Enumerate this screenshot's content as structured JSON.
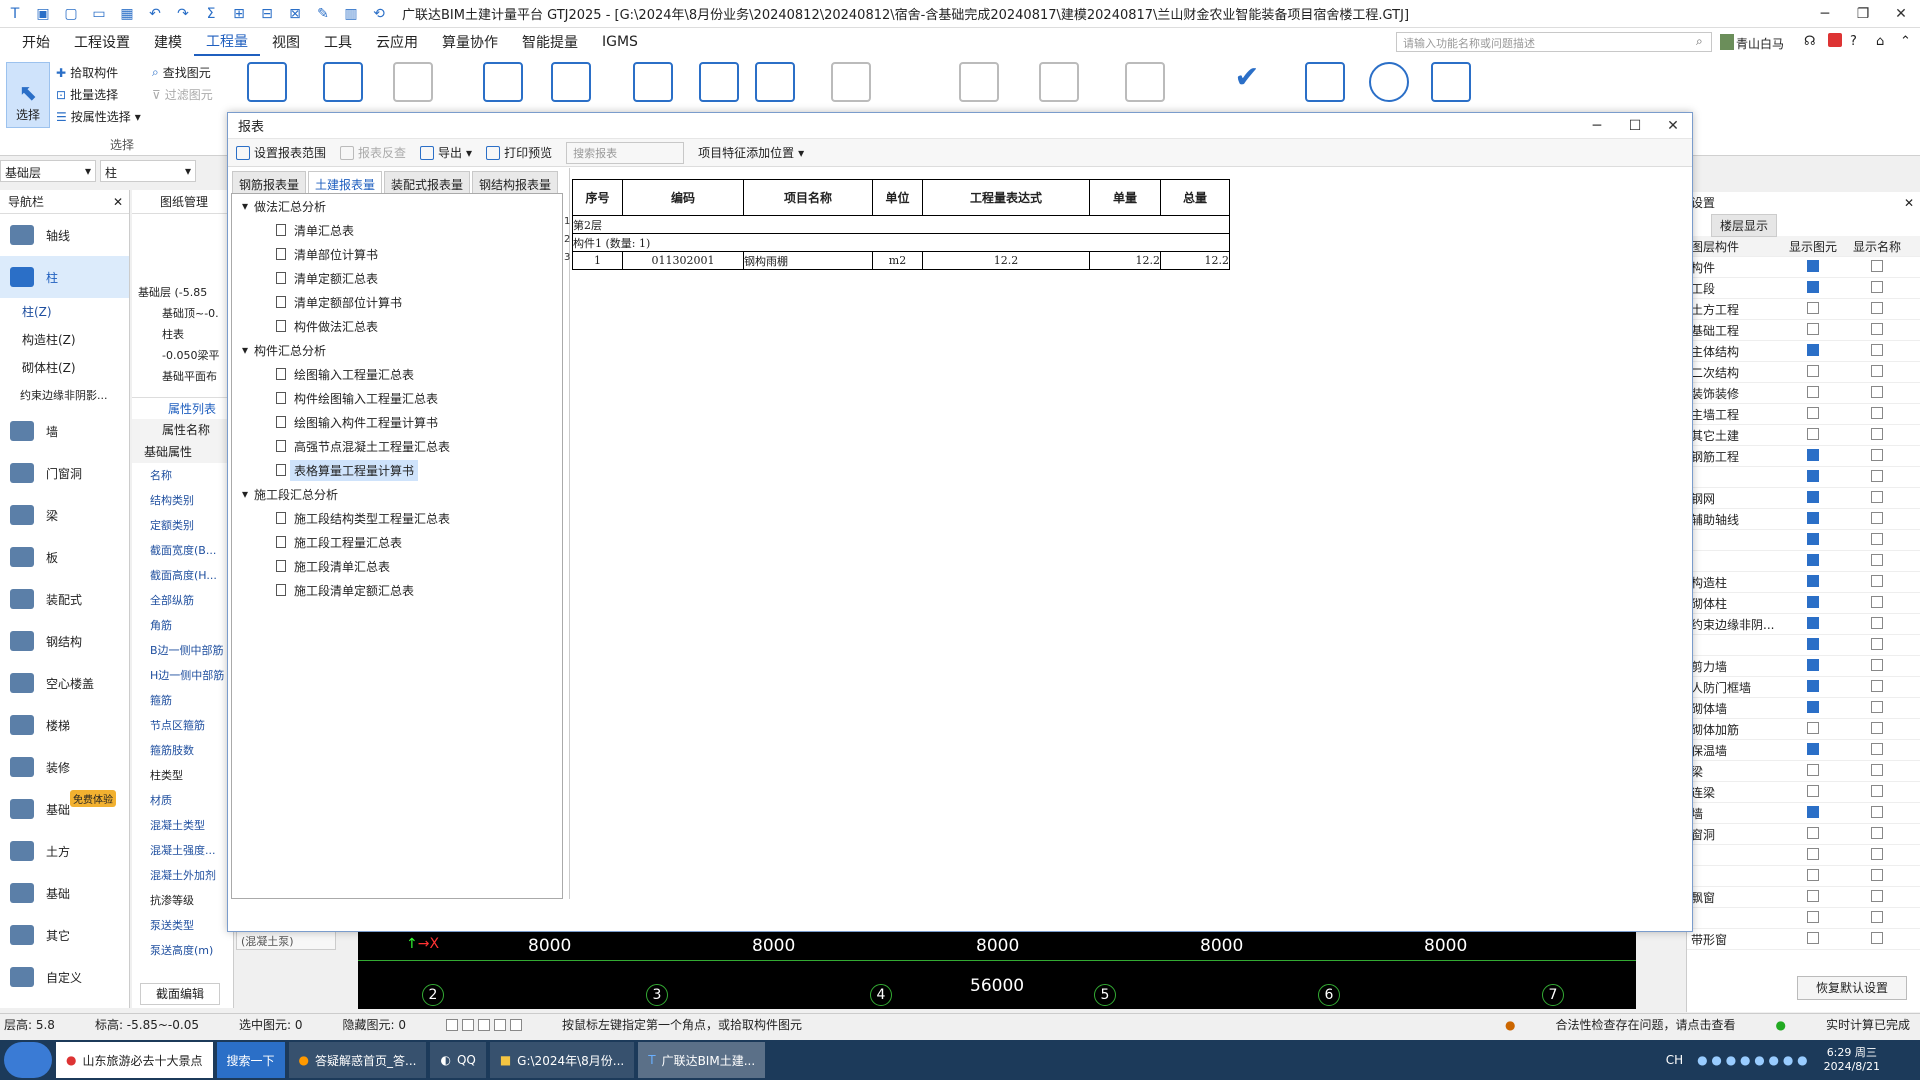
{
  "window": {
    "title": "广联达BIM土建计量平台 GTJ2025 - [G:\\2024年\\8月份业务\\20240812\\20240812\\宿舍-含基础完成20240817\\建模20240817\\兰山财金农业智能装备项目宿舍楼工程.GTJ]"
  },
  "menu": {
    "items": [
      "开始",
      "工程设置",
      "建模",
      "工程量",
      "视图",
      "工具",
      "云应用",
      "算量协作",
      "智能提量",
      "IGMS"
    ]
  },
  "search": {
    "placeholder": "请输入功能名称或问题描述"
  },
  "user": {
    "name": "青山白马"
  },
  "ribbon": {
    "select_label": "选择",
    "pick_label": "拾取构件",
    "batch_label": "批量选择",
    "byprop_label": "按属性选择",
    "find_label": "查找图元",
    "filter_label": "过滤图元",
    "group_label": "选择"
  },
  "floor_select": {
    "value": "基础层",
    "type": "柱"
  },
  "leftnav": {
    "title": "导航栏",
    "items": [
      "轴线",
      "柱",
      "墙",
      "门窗洞",
      "梁",
      "板",
      "装配式",
      "钢结构",
      "空心楼盖",
      "楼梯",
      "装修",
      "基础",
      "土方",
      "基础",
      "其它",
      "自定义"
    ],
    "sub": [
      "柱(Z)",
      "构造柱(Z)",
      "砌体柱(Z)",
      "约束边缘非阴影..."
    ],
    "badge": "免费体验"
  },
  "midpanel": {
    "title": "图纸管理",
    "tree": [
      "基础层 (-5.85",
      "基础顶~-0.",
      "柱表",
      "-0.050梁平",
      "基础平面布"
    ],
    "attr_title": "属性列表",
    "attr_col": "属性名称",
    "attr_group": "基础属性",
    "attrs": [
      "名称",
      "结构类别",
      "定额类别",
      "截面宽度(B...",
      "截面高度(H...",
      "全部纵筋",
      "角筋",
      "B边一侧中部筋",
      "H边一侧中部筋",
      "箍筋",
      "节点区箍筋",
      "箍筋肢数",
      "柱类型",
      "材质",
      "混凝土类型",
      "混凝土强度...",
      "混凝土外加剂",
      "抗渗等级",
      "泵送类型",
      "泵送高度(m)"
    ],
    "pump_value": "(混凝土泵)",
    "section_edit": "截面编辑"
  },
  "report": {
    "title": "报表",
    "toolbar": {
      "range": "设置报表范围",
      "review": "报表反查",
      "export": "导出",
      "print": "打印预览",
      "search_placeholder": "搜索报表",
      "feature": "项目特征添加位置"
    },
    "tabs": [
      "钢筋报表量",
      "土建报表量",
      "装配式报表量",
      "钢结构报表量"
    ],
    "groups": [
      {
        "name": "做法汇总分析",
        "items": [
          "清单汇总表",
          "清单部位计算书",
          "清单定额汇总表",
          "清单定额部位计算书",
          "构件做法汇总表"
        ]
      },
      {
        "name": "构件汇总分析",
        "items": [
          "绘图输入工程量汇总表",
          "构件绘图输入工程量汇总表",
          "绘图输入构件工程量计算书",
          "高强节点混凝土工程量汇总表",
          "表格算量工程量计算书"
        ]
      },
      {
        "name": "施工段汇总分析",
        "items": [
          "施工段结构类型工程量汇总表",
          "施工段工程量汇总表",
          "施工段清单汇总表",
          "施工段清单定额汇总表"
        ]
      }
    ],
    "table": {
      "headers": [
        "序号",
        "编码",
        "项目名称",
        "单位",
        "工程量表达式",
        "单量",
        "总量"
      ],
      "floor": "第2层",
      "comp": "构件1 (数量: 1)",
      "row": [
        "1",
        "011302001",
        "钢构雨棚",
        "m2",
        "12.2",
        "12.2",
        "12.2"
      ],
      "rownums": [
        "1",
        "2",
        "3"
      ]
    }
  },
  "cad": {
    "dims": [
      "8000",
      "8000",
      "8000",
      "8000",
      "8000"
    ],
    "total": "56000",
    "axes": [
      "2",
      "3",
      "4",
      "5",
      "6",
      "7"
    ]
  },
  "rightpanel": {
    "title": "设置",
    "tab": "楼层显示",
    "col1": "图层构件",
    "col2": "显示图元",
    "col3": "显示名称",
    "rows": [
      "构件",
      "工段",
      "土方工程",
      "基础工程",
      "主体结构",
      "二次结构",
      "装饰装修",
      "主墙工程",
      "其它土建",
      "钢筋工程",
      "",
      "钢网",
      "辅助轴线",
      "",
      "",
      "构造柱",
      "砌体柱",
      "约束边缘非阴...",
      "",
      "剪力墙",
      "人防门框墙",
      "砌体墙",
      "砌体加筋",
      "保温墙",
      "梁",
      "连梁",
      "墙",
      "窗洞",
      "",
      "",
      "飘窗",
      "",
      "带形窗"
    ],
    "checked": [
      true,
      true,
      false,
      false,
      true,
      false,
      false,
      false,
      false,
      true,
      true,
      true,
      true,
      true,
      true,
      true,
      true,
      true,
      true,
      true,
      true,
      true,
      false,
      true,
      false,
      false,
      true,
      false,
      false,
      false,
      false,
      false,
      false
    ],
    "restore": "恢复默认设置"
  },
  "status": {
    "floor_h": "层高: 5.8",
    "elev": "标高: -5.85~-0.05",
    "selected": "选中图元: 0",
    "hidden": "隐藏图元: 0",
    "hint": "按鼠标左键指定第一个角点，或拾取构件图元",
    "check": "合法性检查存在问题，请点击查看",
    "realtime": "实时计算已完成"
  },
  "taskbar": {
    "items": [
      "山东旅游必去十大景点",
      "搜索一下",
      "答疑解惑首页_答...",
      "QQ",
      "G:\\2024年\\8月份...",
      "广联达BIM土建..."
    ],
    "time": "6:29 周三",
    "date": "2024/8/21",
    "ime": "CH"
  },
  "colors": {
    "accent": "#1f5fbf",
    "select_bg": "#cfe3fb",
    "cad_bg": "#000000",
    "taskbar": "#1c3a5a"
  }
}
